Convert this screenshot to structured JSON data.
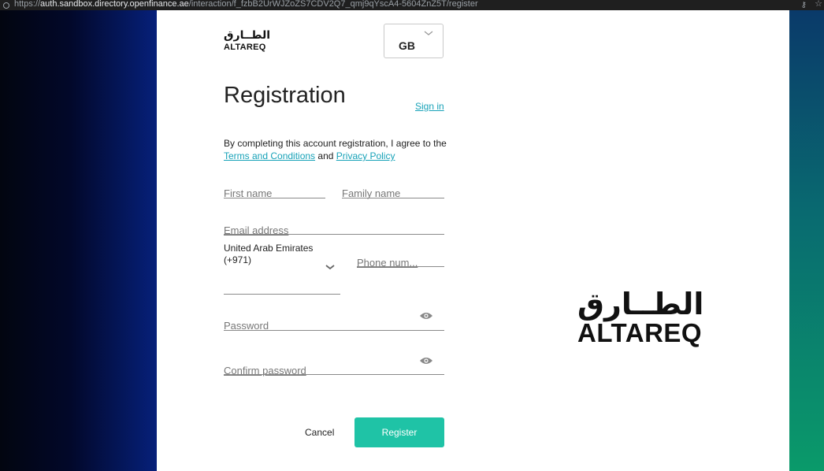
{
  "browser": {
    "url_prefix": "https://",
    "url_host": "auth.sandbox.directory.openfinance.ae",
    "url_path": "/interaction/f_fzbB2UrWJZoZS7CDV2Q7_qmj9qYscA4-5604ZnZ5T/register"
  },
  "brand": {
    "arabic": "الطــارق",
    "latin": "ALTAREQ",
    "accent": "#1fc3a6"
  },
  "language": {
    "selected": "GB"
  },
  "page": {
    "title": "Registration",
    "sign_in": "Sign in",
    "agree_text": "By completing this account registration, I agree to the",
    "terms": "Terms and Conditions",
    "and": "and",
    "privacy": "Privacy Policy"
  },
  "form": {
    "first_name": "First name",
    "family_name": "Family name",
    "email": "Email address",
    "country_name": "United Arab Emirates",
    "country_code": "(+971)",
    "phone": "Phone num...",
    "password": "Password",
    "confirm_password": "Confirm password"
  },
  "actions": {
    "cancel": "Cancel",
    "register": "Register"
  }
}
